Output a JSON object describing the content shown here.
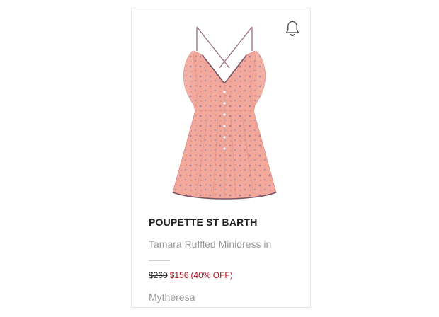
{
  "product": {
    "brand": "POUPETTE ST BARTH",
    "title": "Tamara Ruffled Minidress in",
    "original_price": "$260",
    "sale_price": "$156",
    "discount": "(40% OFF)",
    "retailer": "Mytheresa"
  },
  "icons": {
    "alert": "bell-icon"
  },
  "colors": {
    "sale": "#b3141f",
    "dress": "#f2a99b"
  }
}
